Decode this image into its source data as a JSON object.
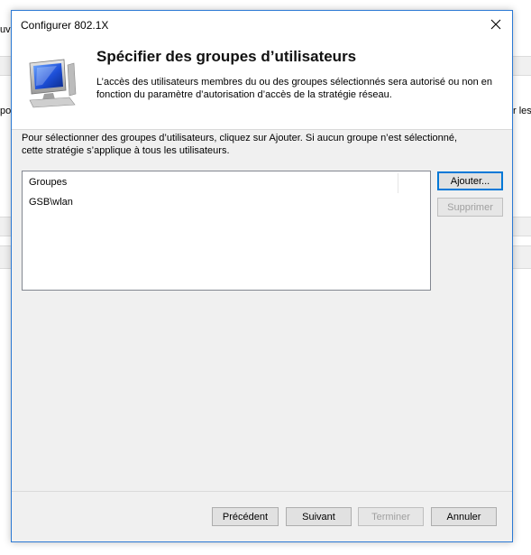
{
  "background_window": {
    "fragments": [
      "uvi",
      "po",
      "r les"
    ]
  },
  "dialog": {
    "title": "Configurer 802.1X",
    "close_glyph": "✕",
    "header": {
      "title": "Spécifier des groupes d’utilisateurs",
      "description": "L’accès des utilisateurs membres du ou des groupes sélectionnés sera autorisé ou non en fonction du paramètre d’autorisation d’accès de la stratégie réseau.",
      "icon": "network-policy-computer-icon"
    },
    "instructions": "Pour sélectionner des groupes d’utilisateurs, cliquez sur Ajouter. Si aucun groupe n’est sélectionné, cette stratégie s’applique à tous les utilisateurs.",
    "groups_list": {
      "column_header": "Groupes",
      "rows": [
        "GSB\\wlan"
      ]
    },
    "buttons": {
      "add": "Ajouter...",
      "remove": "Supprimer",
      "previous": "Précédent",
      "next": "Suivant",
      "finish": "Terminer",
      "cancel": "Annuler"
    },
    "colors": {
      "accent": "#0078d7",
      "dialog_bg": "#f0f0f0",
      "border": "#2b79d4"
    }
  }
}
